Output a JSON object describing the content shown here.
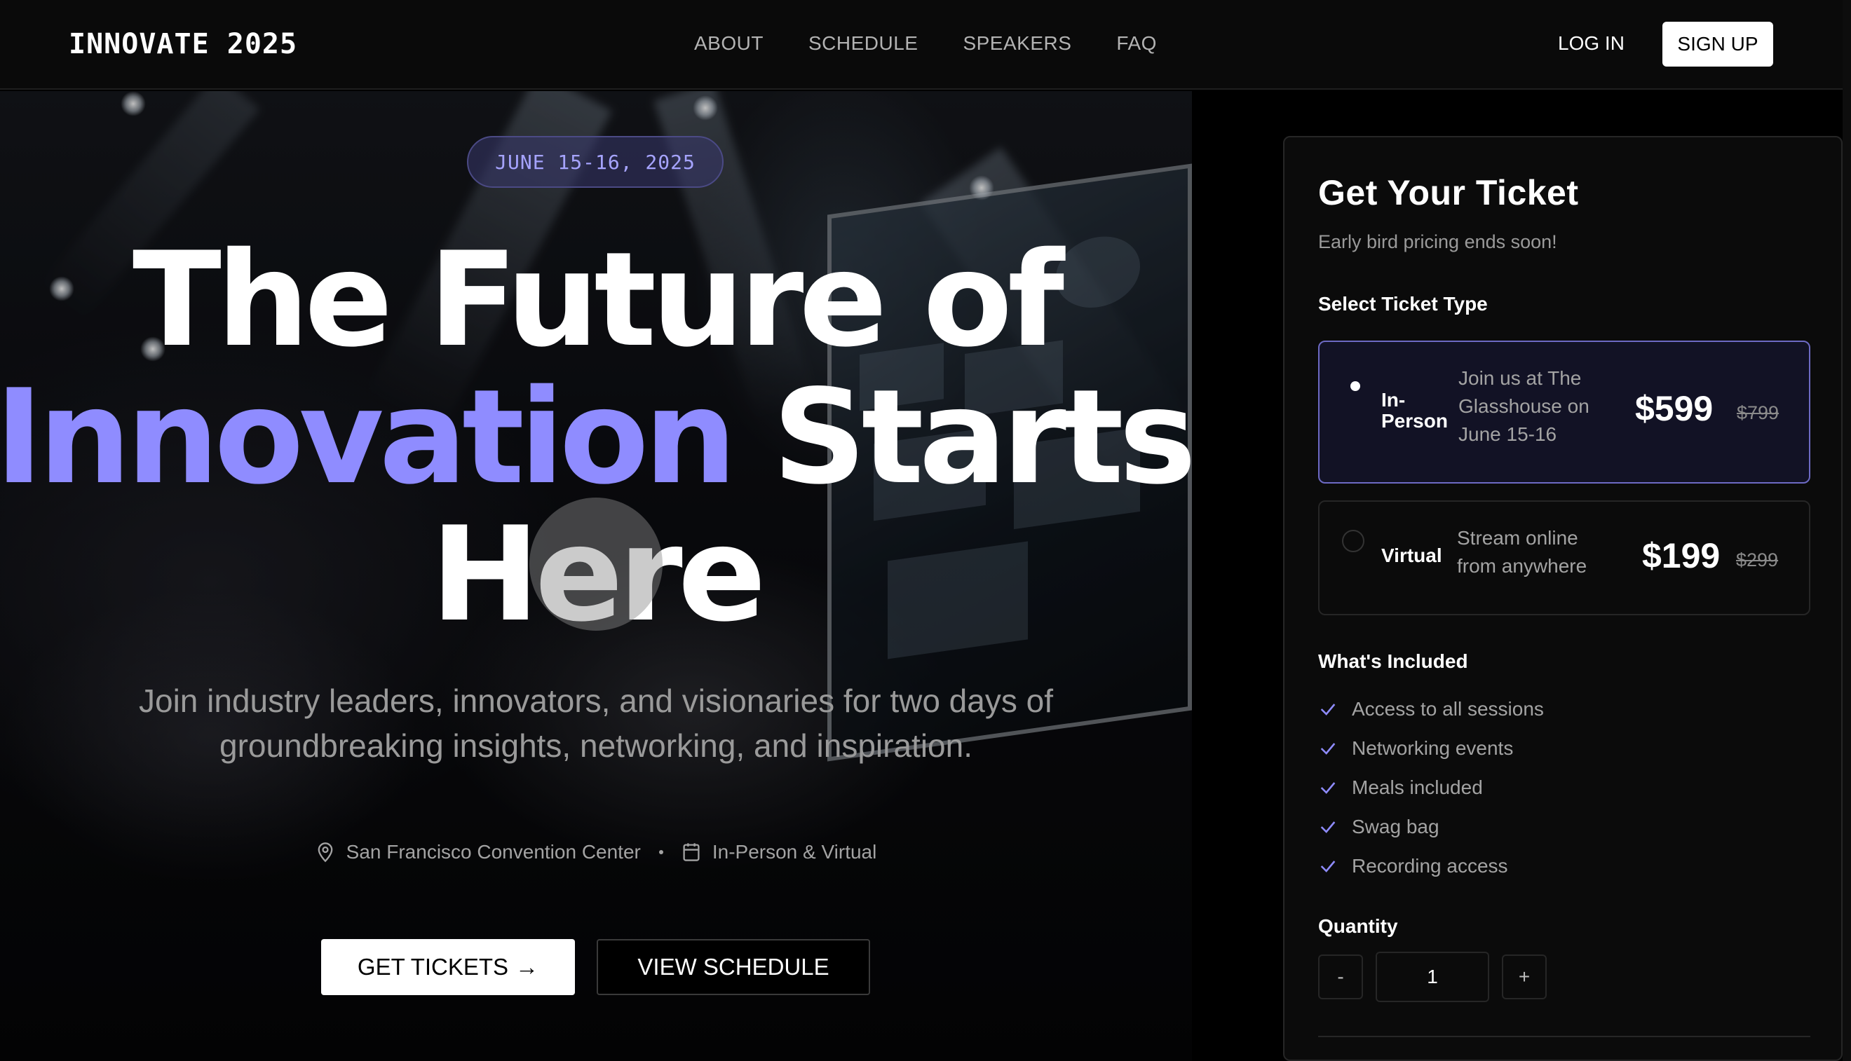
{
  "brand": "INNOVATE 2025",
  "nav": {
    "links": [
      "ABOUT",
      "SCHEDULE",
      "SPEAKERS",
      "FAQ"
    ],
    "login": "LOG IN",
    "signup": "SIGN UP"
  },
  "hero": {
    "date": "JUNE 15-16, 2025",
    "headline": {
      "line1": "The Future of",
      "accent": "Innovation",
      "line2_rest": "Starts",
      "line3": "Here"
    },
    "subtitle": "Join industry leaders, innovators, and visionaries for two days of groundbreaking insights, networking, and inspiration.",
    "location": "San Francisco Convention Center",
    "format": "In-Person & Virtual",
    "primary_cta": "GET TICKETS",
    "primary_cta_arrow": "→",
    "secondary_cta": "VIEW SCHEDULE"
  },
  "ticket": {
    "title": "Get Your Ticket",
    "subtitle": "Early bird pricing ends soon!",
    "select_label": "Select Ticket Type",
    "options": [
      {
        "name_line1": "In-",
        "name_line2": "Person",
        "desc_line1": "Join us at The",
        "desc_line2": "Glasshouse on",
        "desc_line3": "June 15-16",
        "price": "$599",
        "old_price": "$799",
        "selected": true
      },
      {
        "name": "Virtual",
        "desc_line1": "Stream online",
        "desc_line2": "from anywhere",
        "price": "$199",
        "old_price": "$299",
        "selected": false
      }
    ],
    "included_label": "What's Included",
    "included": [
      "Access to all sessions",
      "Networking events",
      "Meals included",
      "Swag bag",
      "Recording access"
    ],
    "quantity_label": "Quantity",
    "quantity": "1",
    "minus": "-",
    "plus": "+"
  },
  "colors": {
    "accent": "#8f8cff",
    "pill_text": "#a6a4ff",
    "selected_border": "#6d6ac4",
    "background": "#000000"
  }
}
